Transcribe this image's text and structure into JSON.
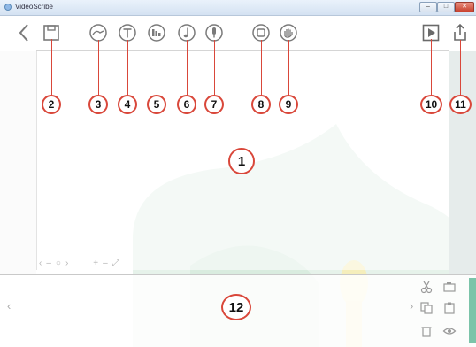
{
  "window": {
    "title": "VideoScribe",
    "controls": {
      "minimize": "–",
      "maximize": "□",
      "close": "✕"
    }
  },
  "toolbar": {
    "tools": [
      {
        "icon": "back-chevron-icon"
      },
      {
        "icon": "save-icon"
      },
      {
        "icon": "image-icon"
      },
      {
        "icon": "text-icon"
      },
      {
        "icon": "chart-icon"
      },
      {
        "icon": "music-icon"
      },
      {
        "icon": "microphone-icon"
      },
      {
        "icon": "background-icon"
      },
      {
        "icon": "hand-icon"
      },
      {
        "icon": "play-icon"
      },
      {
        "icon": "share-icon"
      }
    ]
  },
  "canvas_nav": {
    "prev": "‹",
    "minus": "–",
    "circle": "○",
    "next": "›",
    "zoom_in": "+",
    "zoom_out": "–",
    "fit": "⤢"
  },
  "timeline": {
    "scroll_left": "‹",
    "scroll_right": "›"
  },
  "callouts": {
    "c1": "1",
    "c2": "2",
    "c3": "3",
    "c4": "4",
    "c5": "5",
    "c6": "6",
    "c7": "7",
    "c8": "8",
    "c9": "9",
    "c10": "10",
    "c11": "11",
    "c12": "12"
  },
  "colors": {
    "callout_ring": "#d9473a",
    "icon_stroke": "#7a7a7a",
    "watermark_green": "#cfe8d6",
    "watermark_gold": "#f2e6a6",
    "accent_tab": "#7bc4a9"
  }
}
